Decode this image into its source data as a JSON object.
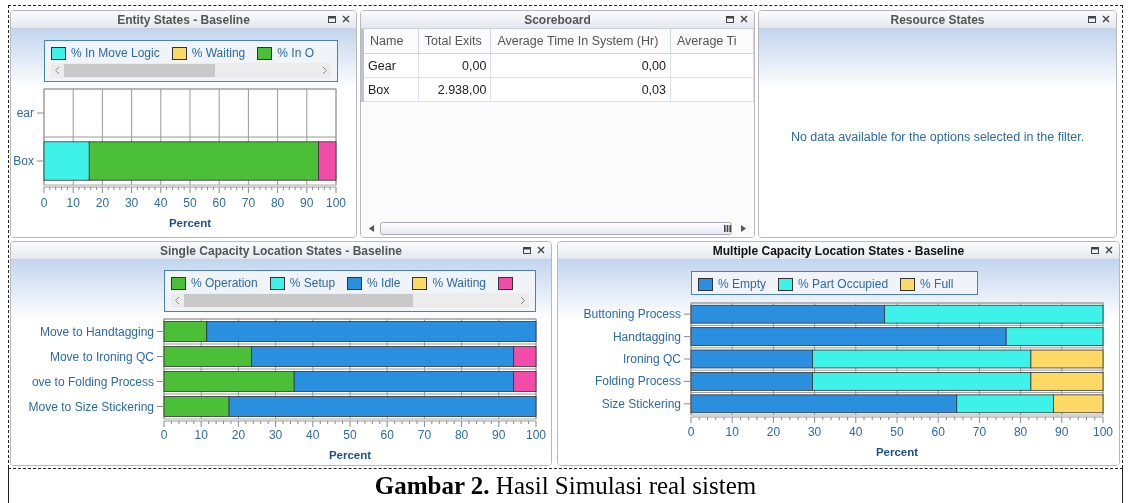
{
  "top_row": [
    {
      "kind": "chart",
      "title": "Entity States - Baseline",
      "active": false,
      "legend": {
        "scrollbar": true,
        "items": [
          {
            "label": "% In Move Logic",
            "color": "#3ef2ea"
          },
          {
            "label": "% Waiting",
            "color": "#ffd966"
          },
          {
            "label": "% In O",
            "color": "#4cbf38"
          }
        ]
      },
      "chart_data": {
        "type": "bar",
        "orientation": "horizontal",
        "stacked": true,
        "grid": true,
        "xlabel": "Percent",
        "categories": [
          "ear",
          "Box"
        ],
        "xlim": [
          0,
          100
        ],
        "xticks": [
          0,
          10,
          20,
          30,
          40,
          50,
          60,
          70,
          80,
          90,
          100
        ],
        "series": [
          {
            "color": "#3ef2ea",
            "values": [
              0,
              15.5
            ]
          },
          {
            "values": [
              0,
              0
            ]
          },
          {
            "color": "#4cbf38",
            "values": [
              0,
              78.5
            ]
          },
          {
            "color": "#f04ca8",
            "values": [
              0,
              6
            ]
          }
        ]
      }
    },
    {
      "kind": "table",
      "title": "Scoreboard",
      "active": false,
      "columns": [
        "Name",
        "Total Exits",
        "Average Time In System (Hr)",
        "Average Ti"
      ],
      "rows": [
        [
          "Gear",
          "0,00",
          "0,00",
          null
        ],
        [
          "Box",
          "2.938,00",
          "0,03",
          null
        ]
      ]
    },
    {
      "kind": "message",
      "title": "Resource States",
      "active": false,
      "message": "No data available for the options selected in the filter."
    }
  ],
  "bottom_row": [
    {
      "kind": "chart",
      "title": "Single Capacity Location States - Baseline",
      "active": false,
      "legend": {
        "scrollbar": true,
        "items": [
          {
            "label": "% Operation",
            "color": "#4cbf38"
          },
          {
            "label": "% Setup",
            "color": "#3ef2ea"
          },
          {
            "label": "% Idle",
            "color": "#2b8fe0"
          },
          {
            "label": "% Waiting",
            "color": "#ffd966"
          },
          {
            "color": "#f04ca8"
          }
        ]
      },
      "chart_data": {
        "type": "bar",
        "orientation": "horizontal",
        "stacked": true,
        "grid": true,
        "xlabel": "Percent",
        "categories": [
          "Move to Handtagging",
          "Move to Ironing QC",
          "ove to Folding Process",
          "Move to Size Stickering"
        ],
        "xlim": [
          0,
          100
        ],
        "xticks": [
          0,
          10,
          20,
          30,
          40,
          50,
          60,
          70,
          80,
          90,
          100
        ],
        "series": [
          {
            "color": "#4cbf38",
            "values": [
              11.5,
              23.5,
              35,
              17.5
            ]
          },
          {
            "values": [
              0,
              0,
              0,
              0
            ]
          },
          {
            "color": "#2b8fe0",
            "values": [
              88.5,
              70.5,
              59,
              82.5
            ]
          },
          {
            "values": [
              0,
              0,
              0,
              0
            ]
          },
          {
            "color": "#f04ca8",
            "values": [
              0,
              6,
              6,
              0
            ]
          }
        ]
      }
    },
    {
      "kind": "chart",
      "title": "Multiple Capacity Location States - Baseline",
      "active": true,
      "legend": {
        "scrollbar": false,
        "items": [
          {
            "label": "% Empty",
            "color": "#2b8fe0"
          },
          {
            "label": "% Part Occupied",
            "color": "#3ef2ea"
          },
          {
            "label": "% Full",
            "color": "#ffd966"
          }
        ]
      },
      "chart_data": {
        "type": "bar",
        "orientation": "horizontal",
        "stacked": true,
        "grid": true,
        "xlabel": "Percent",
        "categories": [
          "Buttoning Process",
          "Handtagging",
          "Ironing QC",
          "Folding Process",
          "Size Stickering"
        ],
        "xlim": [
          0,
          100
        ],
        "xticks": [
          0,
          10,
          20,
          30,
          40,
          50,
          60,
          70,
          80,
          90,
          100
        ],
        "series": [
          {
            "color": "#2b8fe0",
            "values": [
              47,
              76.5,
              29.5,
              29.5,
              64.5
            ]
          },
          {
            "color": "#3ef2ea",
            "values": [
              53,
              23.5,
              53,
              53,
              23.5
            ]
          },
          {
            "color": "#ffd966",
            "values": [
              0,
              0,
              17.5,
              17.5,
              12
            ]
          }
        ]
      }
    }
  ],
  "caption": "**Gambar 2.** Hasil Simulasi real sistem"
}
